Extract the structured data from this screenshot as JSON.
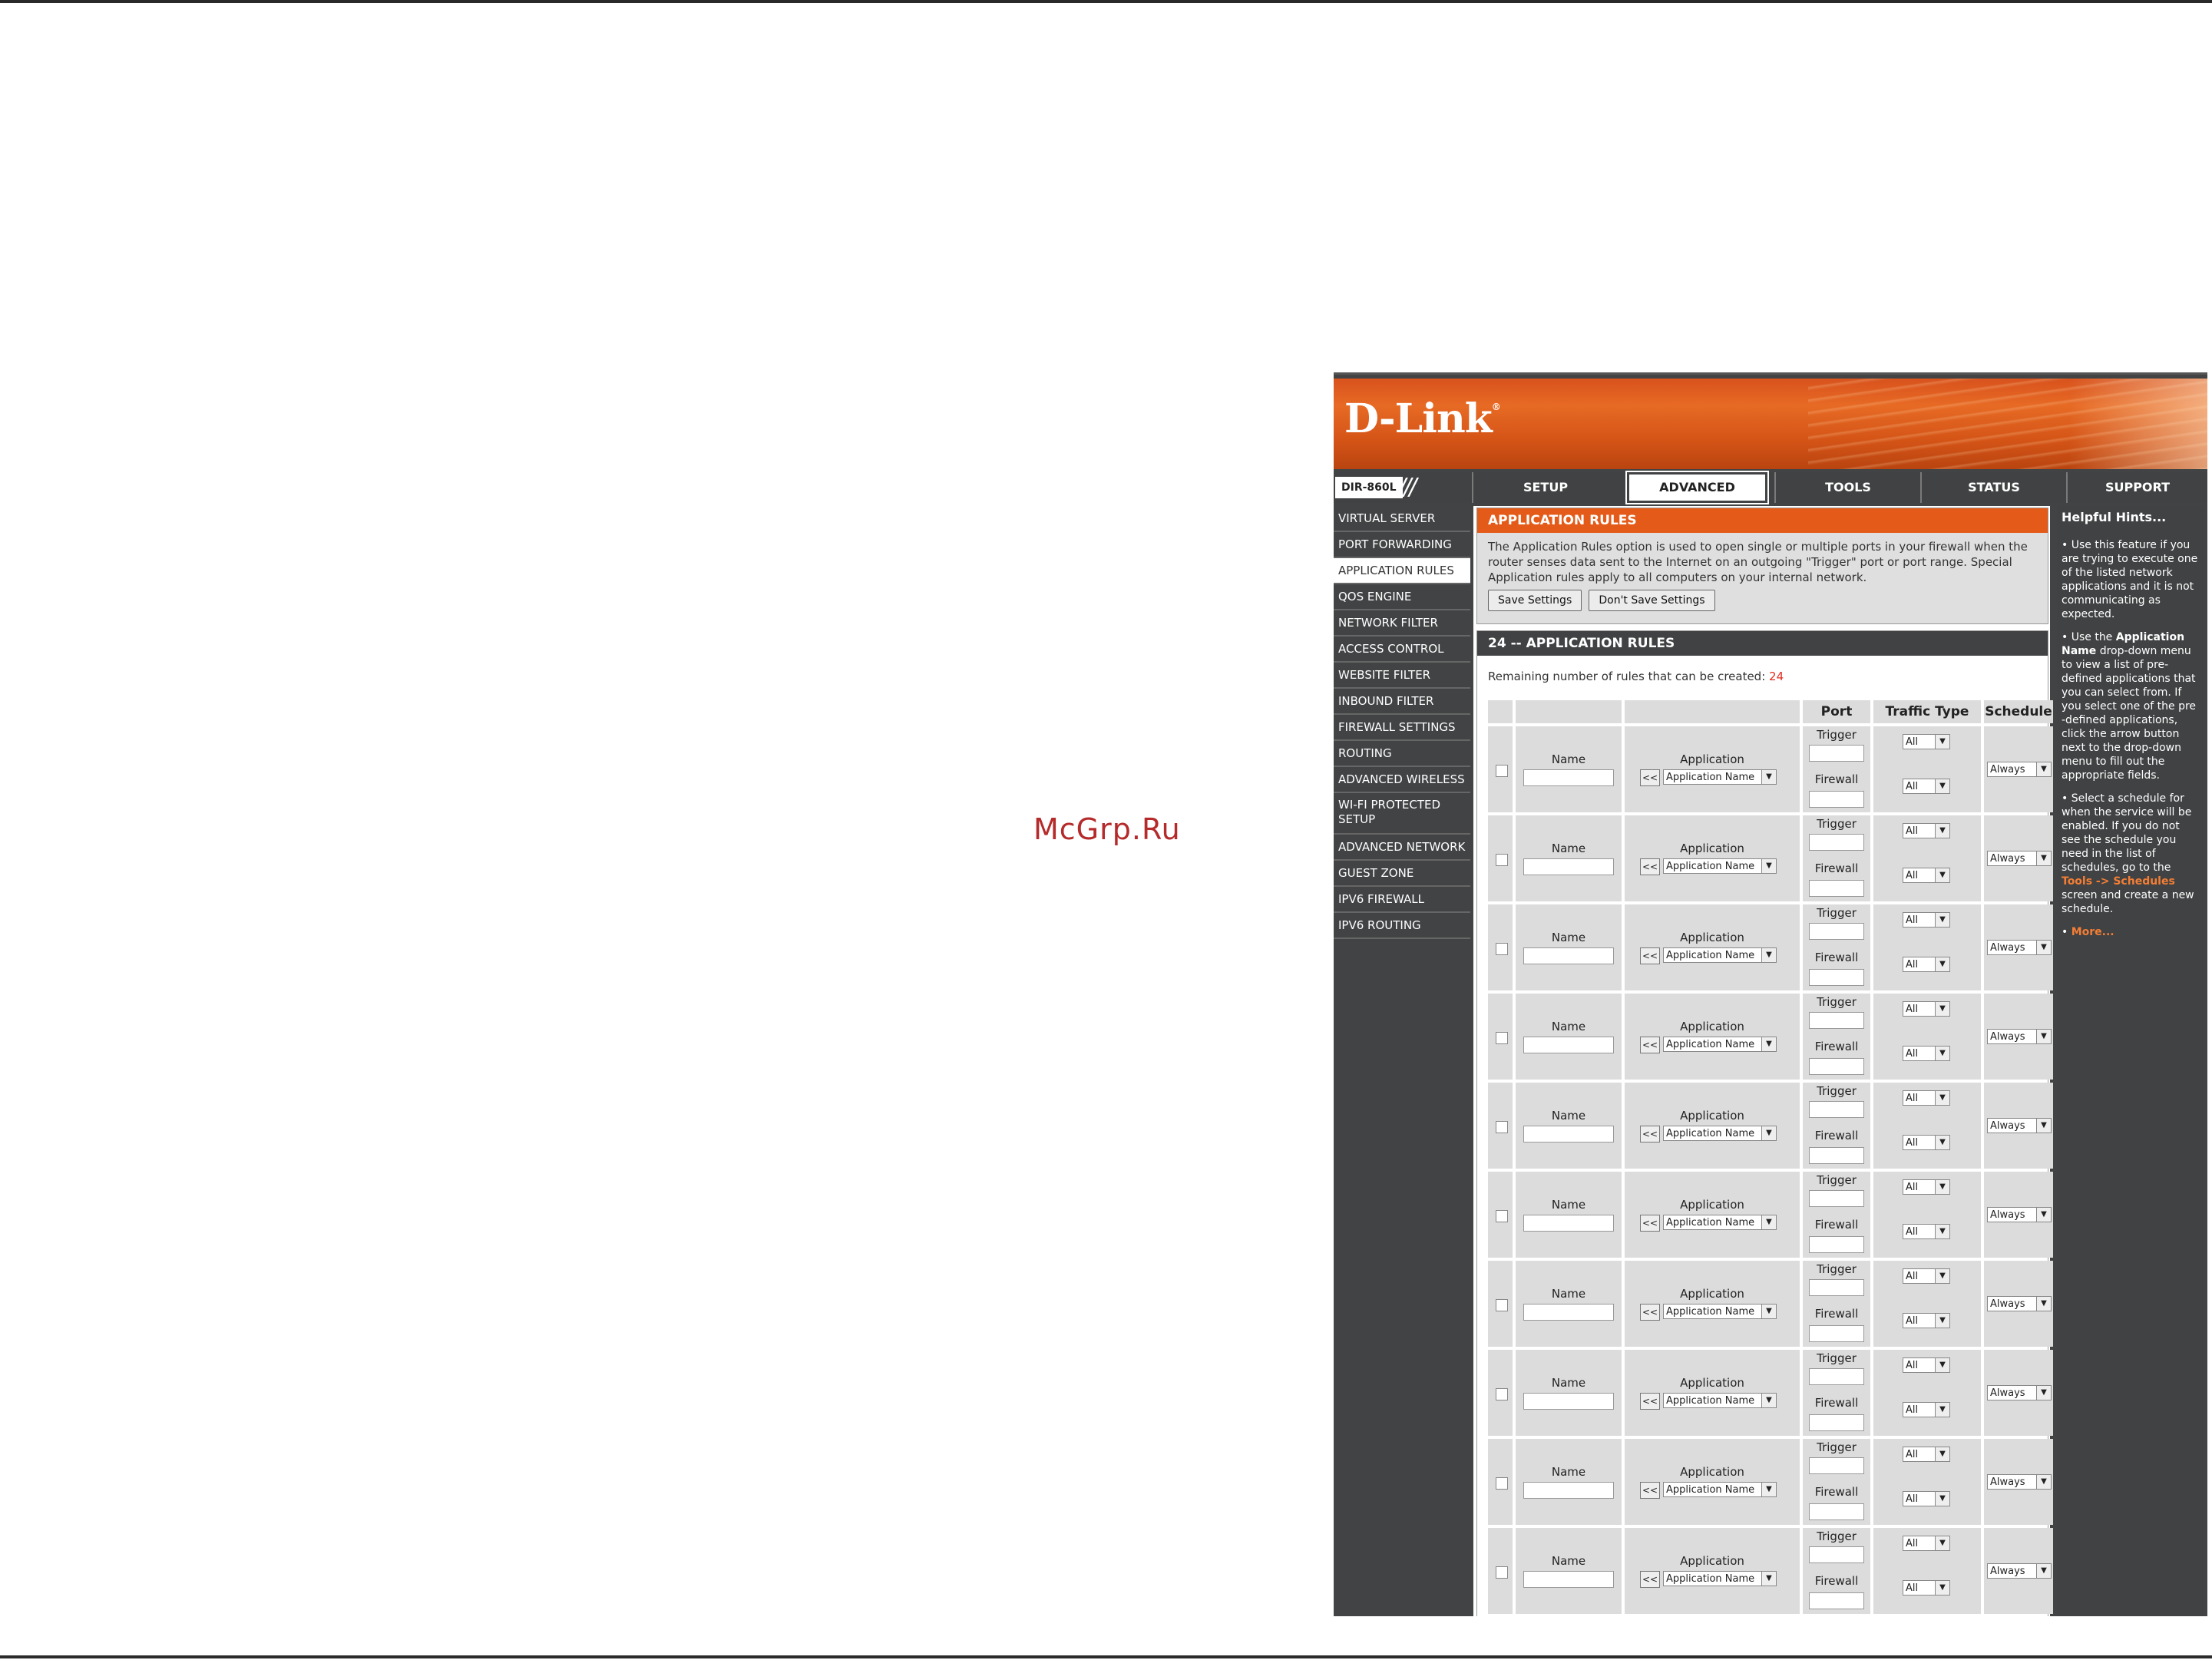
{
  "watermark": "McGrp.Ru",
  "brand": {
    "logo": "D-Link",
    "trademark": "®",
    "model": "DIR-860L"
  },
  "tabs": [
    {
      "label": "SETUP"
    },
    {
      "label": "ADVANCED"
    },
    {
      "label": "TOOLS"
    },
    {
      "label": "STATUS"
    },
    {
      "label": "SUPPORT"
    }
  ],
  "sidebar": [
    "VIRTUAL SERVER",
    "PORT FORWARDING",
    "APPLICATION RULES",
    "QOS ENGINE",
    "NETWORK FILTER",
    "ACCESS CONTROL",
    "WEBSITE FILTER",
    "INBOUND FILTER",
    "FIREWALL SETTINGS",
    "ROUTING",
    "ADVANCED WIRELESS",
    "WI-FI PROTECTED SETUP",
    "ADVANCED NETWORK",
    "GUEST ZONE",
    "IPV6 FIREWALL",
    "IPV6 ROUTING"
  ],
  "app_rules": {
    "title": "APPLICATION RULES",
    "description": "The Application Rules option is used to open single or multiple ports in your firewall when the router senses data sent to the Internet on an outgoing \"Trigger\" port or port range. Special Application rules apply to all computers on your internal network.",
    "save_button": "Save Settings",
    "dont_save_button": "Don't Save Settings"
  },
  "rules_table": {
    "title": "24 -- APPLICATION RULES",
    "remaining_label": "Remaining number of rules that can be created:",
    "remaining_count": "24",
    "col_port": "Port",
    "col_traffic": "Traffic Type",
    "col_schedule": "Schedule",
    "row": {
      "name_label": "Name",
      "application_label": "Application",
      "copy_button": "<<",
      "app_select": "Application Name",
      "trigger_label": "Trigger",
      "firewall_label": "Firewall",
      "traffic_value": "All",
      "schedule_value": "Always"
    },
    "visible_rows": 10
  },
  "hints": {
    "title": "Helpful Hints...",
    "hint1": "Use this feature if you are trying to execute one of the listed network applications and it is not communicating as expected.",
    "hint2_pre": "Use the",
    "hint2_bold": "Application Name",
    "hint2_post": "drop-down menu to view a list of pre-defined applications that you can select from. If you select one of the pre -defined applications, click the arrow button next to the drop-down menu to fill out the appropriate fields.",
    "hint3_pre": "Select a schedule for when the service will be enabled. If you do not see the schedule you need in the list of schedules, go to the",
    "hint3_link": "Tools -> Schedules",
    "hint3_post": "screen and create a new schedule.",
    "more": "More..."
  }
}
